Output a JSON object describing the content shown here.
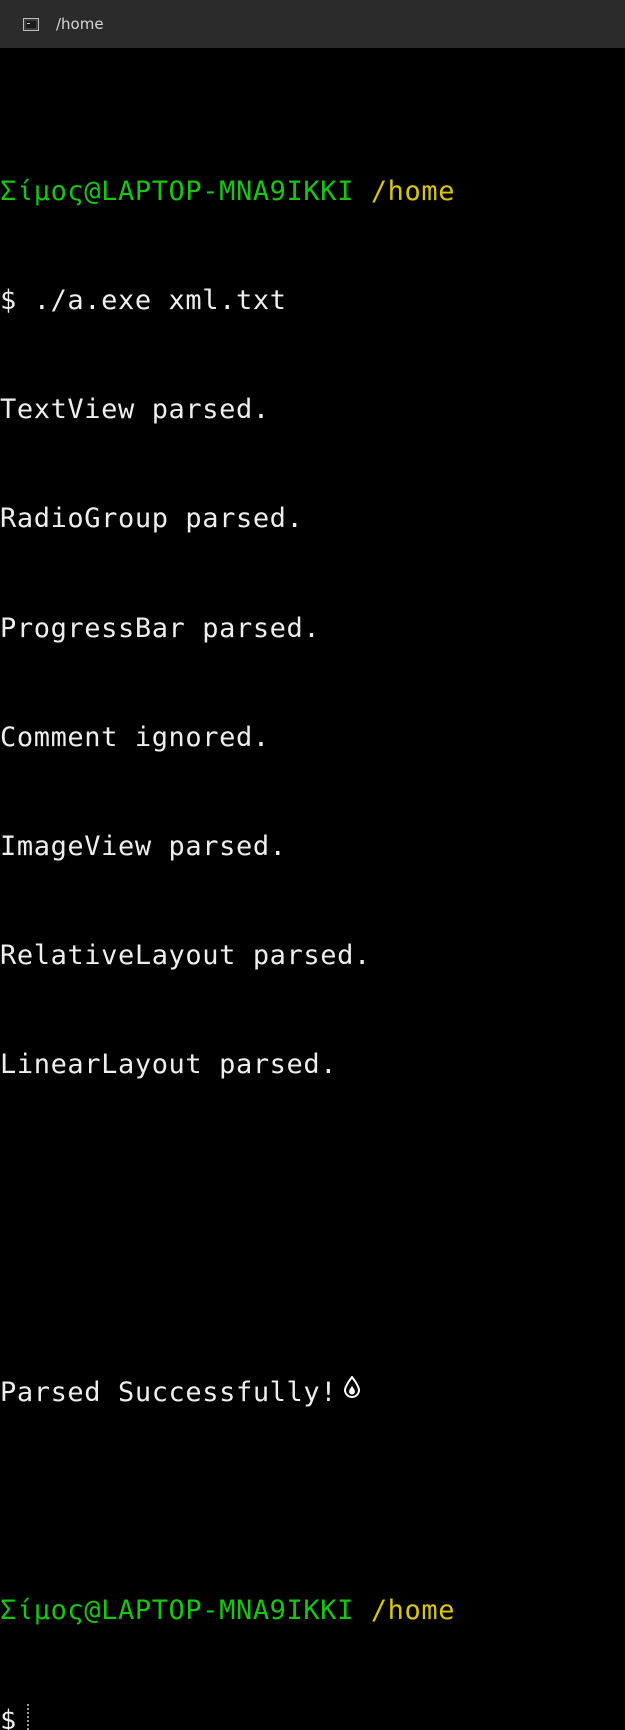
{
  "window": {
    "title": "/home",
    "icon": "terminal-app-icon"
  },
  "prompt1": {
    "user": "Σίμος@LAPTOP-MNA9IKKI",
    "path": "/home",
    "symbol": "$",
    "command": "./a.exe xml.txt"
  },
  "output": [
    "TextView parsed.",
    "RadioGroup parsed.",
    "ProgressBar parsed.",
    "Comment ignored.",
    "ImageView parsed.",
    "RelativeLayout parsed.",
    "LinearLayout parsed."
  ],
  "success_message": "Parsed Successfully!",
  "success_icon": "drop-icon",
  "prompt2": {
    "user": "Σίμος@LAPTOP-MNA9IKKI",
    "path": "/home",
    "symbol": "$"
  },
  "colors": {
    "background": "#000000",
    "titlebar": "#2b2b2b",
    "text": "#eeeeee",
    "user": "#17c614",
    "path": "#d9c60a"
  }
}
